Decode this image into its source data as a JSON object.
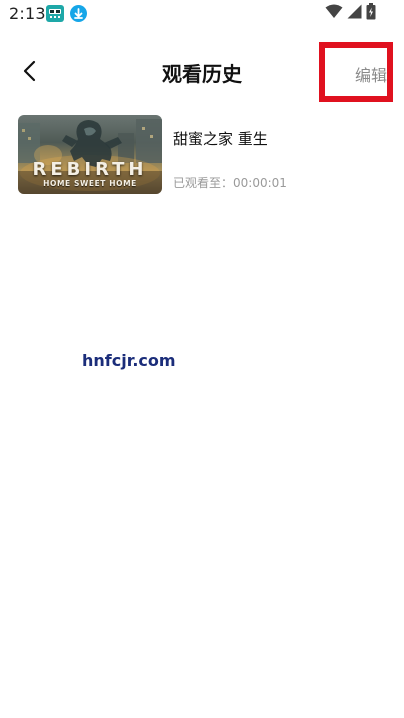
{
  "status_bar": {
    "time": "2:13",
    "icons": [
      "app-notification-icon",
      "download-icon",
      "wifi-icon",
      "signal-icon",
      "battery-charging-icon"
    ]
  },
  "header": {
    "title": "观看历史",
    "back_icon": "chevron-left-icon",
    "edit_label": "编辑"
  },
  "history": {
    "items": [
      {
        "title": "甜蜜之家 重生",
        "progress": "已观看至：00:00:01",
        "thumbnail_title": "REBIRTH",
        "thumbnail_subtitle": "HOME SWEET HOME"
      }
    ]
  },
  "watermark": "hnfcjr.com",
  "colors": {
    "edit_highlight": "#e0111f",
    "muted_text": "#9a9a9a",
    "watermark": "#1b2d7a"
  }
}
